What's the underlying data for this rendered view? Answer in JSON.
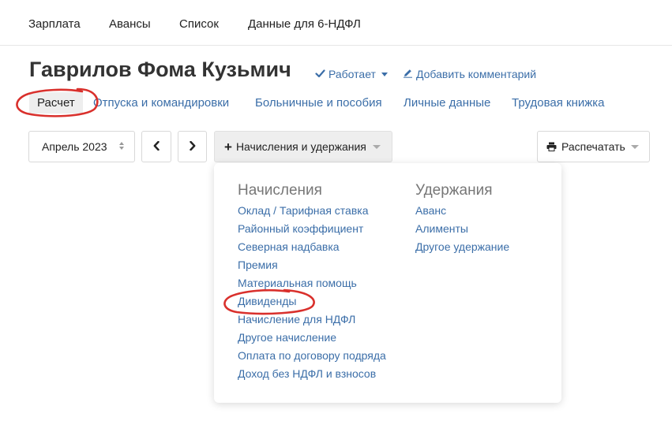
{
  "topnav": {
    "items": [
      "Зарплата",
      "Авансы",
      "Список",
      "Данные для 6-НДФЛ"
    ]
  },
  "employee": {
    "name": "Гаврилов Фома Кузьмич",
    "status": "Работает",
    "comment_link": "Добавить комментарий"
  },
  "subtabs": {
    "items": [
      "Расчет",
      "Отпуска и командировки",
      "Больничные и пособия",
      "Личные данные",
      "Трудовая книжка"
    ],
    "active": "Расчет"
  },
  "toolbar": {
    "month": "Апрель 2023",
    "prev_label": "‹",
    "next_label": "›",
    "accruals_label": "Начисления и удержания",
    "print_label": "Распечатать"
  },
  "dropdown": {
    "accruals_heading": "Начисления",
    "accruals": [
      "Оклад / Тарифная ставка",
      "Районный коэффициент",
      "Северная надбавка",
      "Премия",
      "Материальная помощь",
      "Дивиденды",
      "Начисление для НДФЛ",
      "Другое начисление",
      "Оплата по договору подряда",
      "Доход без НДФЛ и взносов"
    ],
    "deductions_heading": "Удержания",
    "deductions": [
      "Аванс",
      "Алименты",
      "Другое удержание"
    ]
  },
  "colors": {
    "link": "#3b6ea8",
    "text": "#222222",
    "annotation": "#d9302c",
    "active_tab_bg": "#eeeeee"
  },
  "icons": {
    "status": "checkmark-icon",
    "comment": "pencil-icon",
    "print": "printer-icon"
  }
}
